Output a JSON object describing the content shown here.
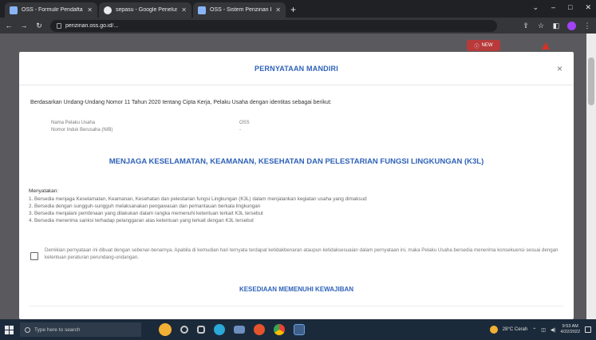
{
  "browser": {
    "tabs": [
      {
        "title": "OSS - Formulir Pendaftaran Perizi",
        "active": false
      },
      {
        "title": "sepasu - Google Penelusuran",
        "active": false
      },
      {
        "title": "OSS - Sistem Perizinan Berusaha",
        "active": true
      }
    ],
    "url": "perizinan.oss.go.id/..."
  },
  "page": {
    "nav_button_label": "NEW"
  },
  "modal": {
    "title": "PERNYATAAN MANDIRI",
    "close_symbol": "×",
    "intro": "Berdasarkan Undang-Undang Nomor 11 Tahun 2020 tentang Cipta Kerja, Pelaku Usaha dengan identitas sebagai berikut:",
    "info": [
      {
        "label": "Nama Pelaku Usaha",
        "value": "OSS"
      },
      {
        "label": "Nomor Induk Berusaha (NIB)",
        "value": "-"
      }
    ],
    "k3l_heading": "MENJAGA KESELAMATAN, KEAMANAN, KESEHATAN DAN PELESTARIAN FUNGSI LINGKUNGAN (K3L)",
    "statement_heading": "Menyatakan:",
    "statements": [
      "1. Bersedia menjaga Keselamatan, Keamanan, Kesehatan dan pelestarian fungsi Lingkungan (K3L) dalam menjalankan kegiatan usaha yang dimaksud",
      "2. Bersedia dengan sungguh-sungguh melaksanakan pengawasan dan pemantauan berkala lingkungan",
      "3. Bersedia menjalani pembinaan yang dilakukan dalam rangka memenuhi ketentuan terkait K3L tersebut",
      "4. Bersedia menerima sanksi terhadap pelanggaran atas ketentuan yang terkait dengan K3L tersebut"
    ],
    "consent_text": "Demikian pernyataan ini dibuat dengan sebenar-benarnya. Apabila di kemudian hari ternyata terdapat ketidakbenaran ataupun ketidaksesuaian dalam pernyataan ini, maka Pelaku Usaha bersedia menerima konsekuensi sesuai dengan ketentuan peraturan perundang-undangan.",
    "consent_checked": false,
    "next_heading": "KESEDIAAN MEMENUHI KEWAJIBAN"
  },
  "taskbar": {
    "search_placeholder": "Type here to search",
    "weather": "28°C Cerah",
    "time": "9:53 AM",
    "date": "4/22/2022"
  }
}
